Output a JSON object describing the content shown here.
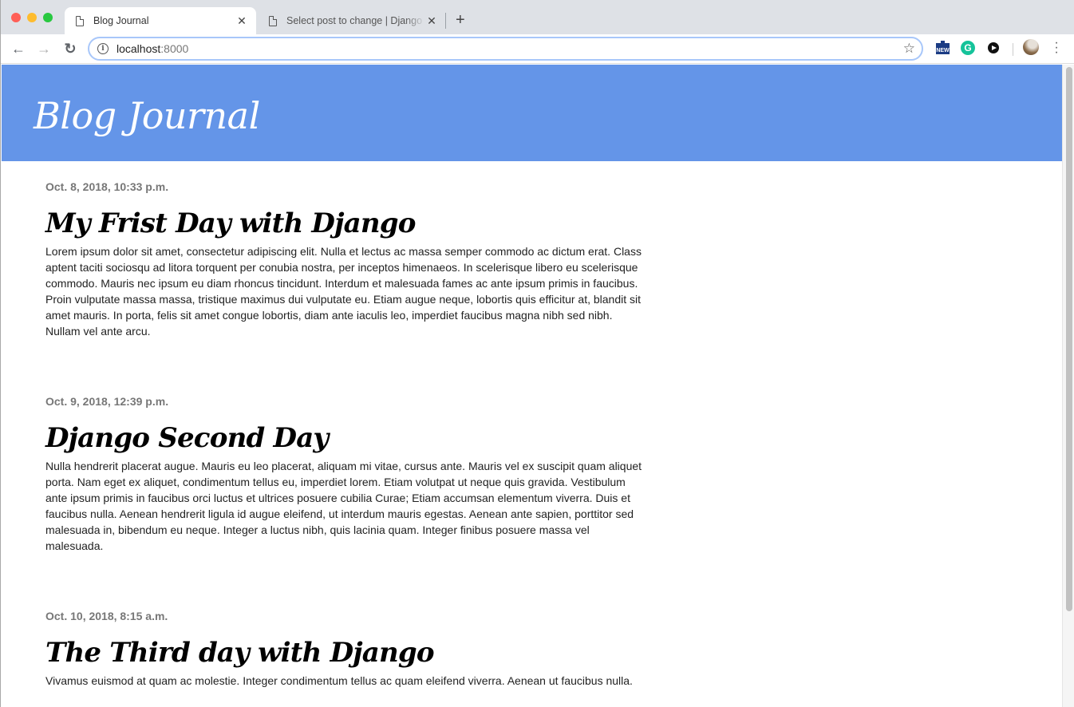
{
  "browser": {
    "tabs": [
      {
        "title": "Blog Journal",
        "active": true
      },
      {
        "title": "Select post to change | Django site admin",
        "active": false
      }
    ],
    "new_tab_label": "+",
    "close_glyph": "✕",
    "url_host": "localhost",
    "url_port": ":8000",
    "info_glyph": "i",
    "star_glyph": "☆",
    "back_glyph": "←",
    "forward_glyph": "→",
    "reload_glyph": "↻",
    "extensions": [
      {
        "name": "news-extension",
        "label": "NEW"
      },
      {
        "name": "grammarly-extension",
        "label": "G"
      },
      {
        "name": "media-extension",
        "label": ""
      }
    ],
    "menu_glyph": "⋮",
    "traffic_light_colors": [
      "#ff5f57",
      "#febc2e",
      "#28c840"
    ]
  },
  "site": {
    "title": "Blog Journal",
    "header_color": "#6495e8"
  },
  "posts": [
    {
      "date": "Oct. 8, 2018, 10:33 p.m.",
      "title": "My Frist Day with Django",
      "body": "Lorem ipsum dolor sit amet, consectetur adipiscing elit. Nulla et lectus ac massa semper commodo ac dictum erat. Class aptent taciti sociosqu ad litora torquent per conubia nostra, per inceptos himenaeos. In scelerisque libero eu scelerisque commodo. Mauris nec ipsum eu diam rhoncus tincidunt. Interdum et malesuada fames ac ante ipsum primis in faucibus. Proin vulputate massa massa, tristique maximus dui vulputate eu. Etiam augue neque, lobortis quis efficitur at, blandit sit amet mauris. In porta, felis sit amet congue lobortis, diam ante iaculis leo, imperdiet faucibus magna nibh sed nibh. Nullam vel ante arcu."
    },
    {
      "date": "Oct. 9, 2018, 12:39 p.m.",
      "title": "Django Second Day",
      "body": "Nulla hendrerit placerat augue. Mauris eu leo placerat, aliquam mi vitae, cursus ante. Mauris vel ex suscipit quam aliquet porta. Nam eget ex aliquet, condimentum tellus eu, imperdiet lorem. Etiam volutpat ut neque quis gravida. Vestibulum ante ipsum primis in faucibus orci luctus et ultrices posuere cubilia Curae; Etiam accumsan elementum viverra. Duis et faucibus nulla. Aenean hendrerit ligula id augue eleifend, ut interdum mauris egestas. Aenean ante sapien, porttitor sed malesuada in, bibendum eu neque. Integer a luctus nibh, quis lacinia quam. Integer finibus posuere massa vel malesuada."
    },
    {
      "date": "Oct. 10, 2018, 8:15 a.m.",
      "title": "The Third day with Django",
      "body": "Vivamus euismod at quam ac molestie. Integer condimentum tellus ac quam eleifend viverra. Aenean ut faucibus nulla."
    }
  ]
}
